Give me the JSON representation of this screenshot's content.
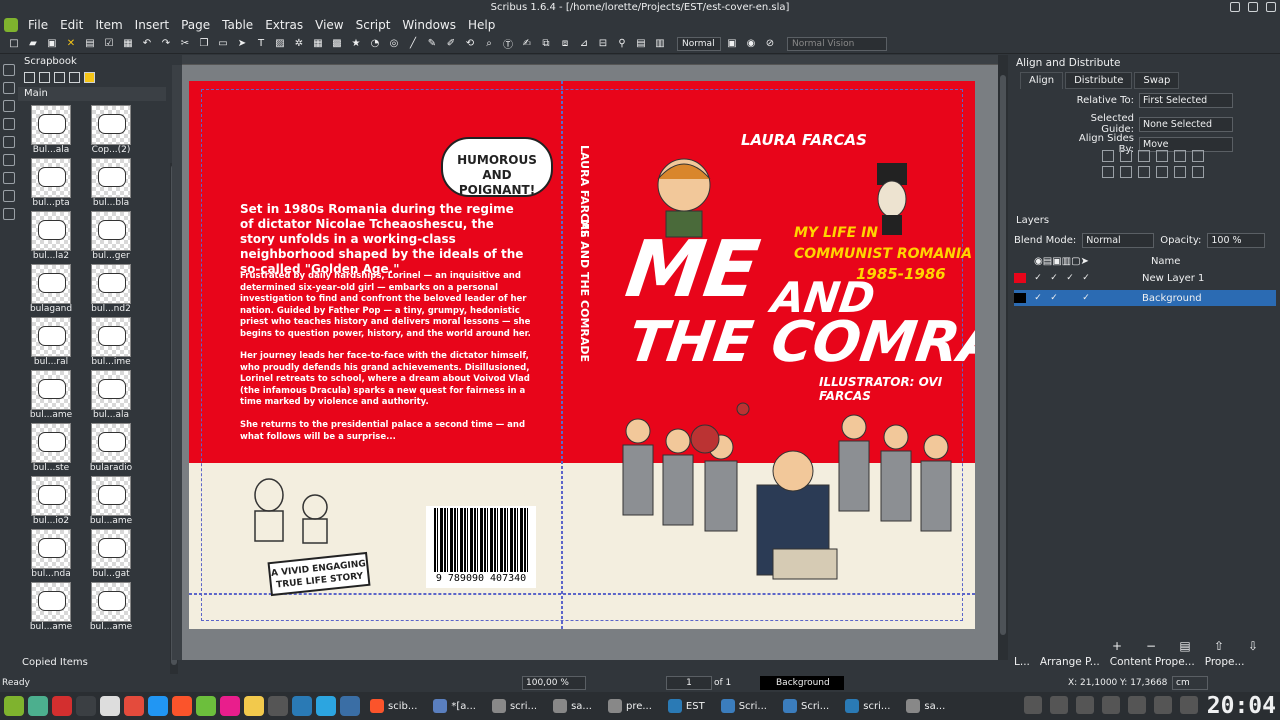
{
  "window": {
    "title": "Scribus 1.6.4 - [/home/lorette/Projects/EST/est-cover-en.sla]"
  },
  "menu": [
    "File",
    "Edit",
    "Item",
    "Insert",
    "Page",
    "Table",
    "Extras",
    "View",
    "Script",
    "Windows",
    "Help"
  ],
  "toolbar": {
    "mode_select": "Normal",
    "vision_select": "Normal Vision"
  },
  "scrapbook": {
    "title": "Scrapbook",
    "tab": "Main",
    "items": [
      "Bul...ala",
      "Cop...(2)",
      "bul...pta",
      "bul...bla",
      "bul...la2",
      "bul...ger",
      "bulagand",
      "bul...nd2",
      "bul...ral",
      "bul...ime",
      "bul...ame",
      "bul...ala",
      "bul...ste",
      "bularadio",
      "bul...io2",
      "bul...ame",
      "bul...nda",
      "bul...gat",
      "bul...ame",
      "bul...ame"
    ],
    "copied_items": "Copied Items"
  },
  "cover": {
    "back_title": "Set in 1980s Romania during the regime of dictator Nicolae Tcheaoshescu, the story unfolds in a working-class neighborhood shaped by the ideals of the so-called \"Golden Age.\"",
    "back_p1": "Frustrated by daily hardships, Lorinel — an inquisitive and determined six-year-old girl — embarks on a personal investigation to find and confront the beloved leader of her nation. Guided by Father Pop — a tiny, grumpy, hedonistic priest who teaches history and delivers moral lessons — she begins to question power, history, and the world around her.",
    "back_p2": "Her journey leads her face-to-face with the dictator himself, who proudly defends his grand achievements. Disillusioned, Lorinel retreats to school, where a dream about Voivod Vlad (the infamous Dracula) sparks a new quest for fairness in a time marked by violence and authority.",
    "back_p3": "She returns to the presidential palace a second time — and what follows will be a surprise...",
    "bubble": "HUMOROUS AND POIGNANT!",
    "sticker": "A VIVID ENGAGING TRUE LIFE STORY",
    "barcode_number": "9 789090 407340",
    "spine_author": "LAURA FARCAS",
    "spine_title": "ME AND THE COMRADE",
    "author": "LAURA FARCAS",
    "subtitle_1": "MY LIFE IN",
    "subtitle_2": "COMMUNIST ROMANIA",
    "years": "1985-1986",
    "title_me": "ME",
    "title_and": "AND",
    "title_comrade": "THE COMRADE",
    "illustrator": "ILLUSTRATOR: OVI FARCAS"
  },
  "align_panel": {
    "title": "Align and Distribute",
    "tabs": [
      "Align",
      "Distribute",
      "Swap"
    ],
    "relative_to_label": "Relative To:",
    "relative_to_value": "First Selected",
    "selected_guide_label": "Selected Guide:",
    "selected_guide_value": "None Selected",
    "align_sides_label": "Align Sides By:",
    "align_sides_value": "Move"
  },
  "layers_panel": {
    "title": "Layers",
    "blend_label": "Blend Mode:",
    "blend_value": "Normal",
    "opacity_label": "Opacity:",
    "opacity_value": "100 %",
    "name_header": "Name",
    "layers": [
      {
        "name": "New Layer 1",
        "color": "#e8051a"
      },
      {
        "name": "Background",
        "color": "#000000"
      }
    ]
  },
  "bottom_tabs": [
    "L...",
    "Arrange P...",
    "Content Prope...",
    "Prope..."
  ],
  "status": {
    "text": "Ready",
    "zoom": "100,00 %",
    "page": "1",
    "of": "of 1",
    "layer": "Background",
    "x": "X: 21,1000",
    "y": "Y: 17,3668",
    "unit": "cm"
  },
  "taskbar": {
    "tasks": [
      "scib...",
      "*[a...",
      "scri...",
      "sa...",
      "pre...",
      "EST",
      "Scri...",
      "Scri...",
      "scri...",
      "sa..."
    ],
    "clock": "20:04"
  }
}
